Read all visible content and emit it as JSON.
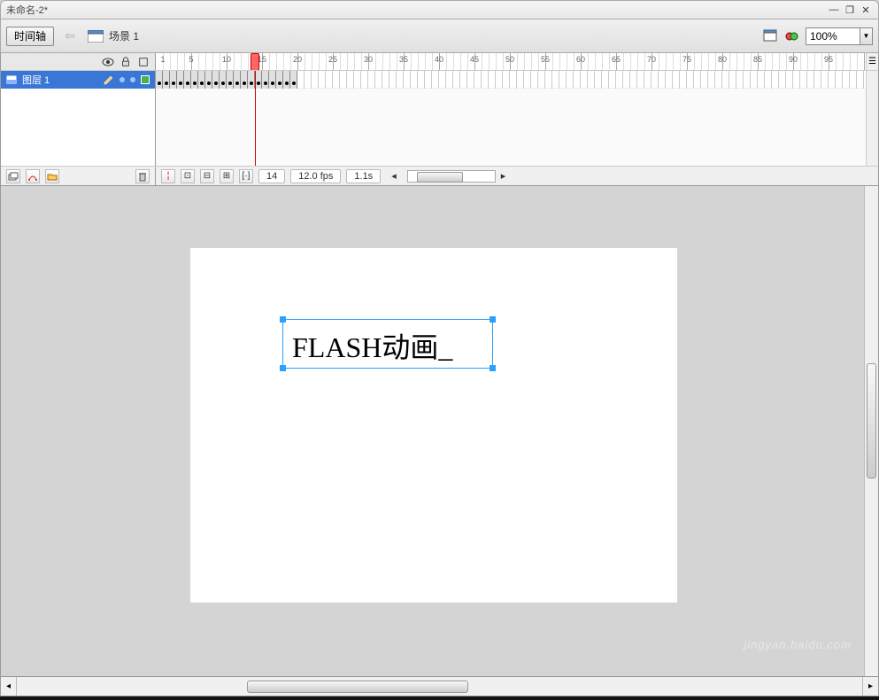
{
  "window": {
    "title": "未命名-2*"
  },
  "scenebar": {
    "timeline_button": "时间轴",
    "scene_label": "场景 1",
    "zoom": "100%"
  },
  "ruler": {
    "labels": [
      "1",
      "5",
      "10",
      "15",
      "20",
      "25",
      "30",
      "35",
      "40",
      "45",
      "50",
      "55",
      "60",
      "65",
      "70",
      "75",
      "80",
      "85",
      "90",
      "95"
    ]
  },
  "layer": {
    "name": "图层 1"
  },
  "frames": {
    "keyframe_count": 20,
    "playhead": 14
  },
  "status": {
    "frame": "14",
    "fps": "12.0 fps",
    "time": "1.1s"
  },
  "stage": {
    "text": "FLASH动画_"
  },
  "watermark": "jingyan.baidu.com"
}
